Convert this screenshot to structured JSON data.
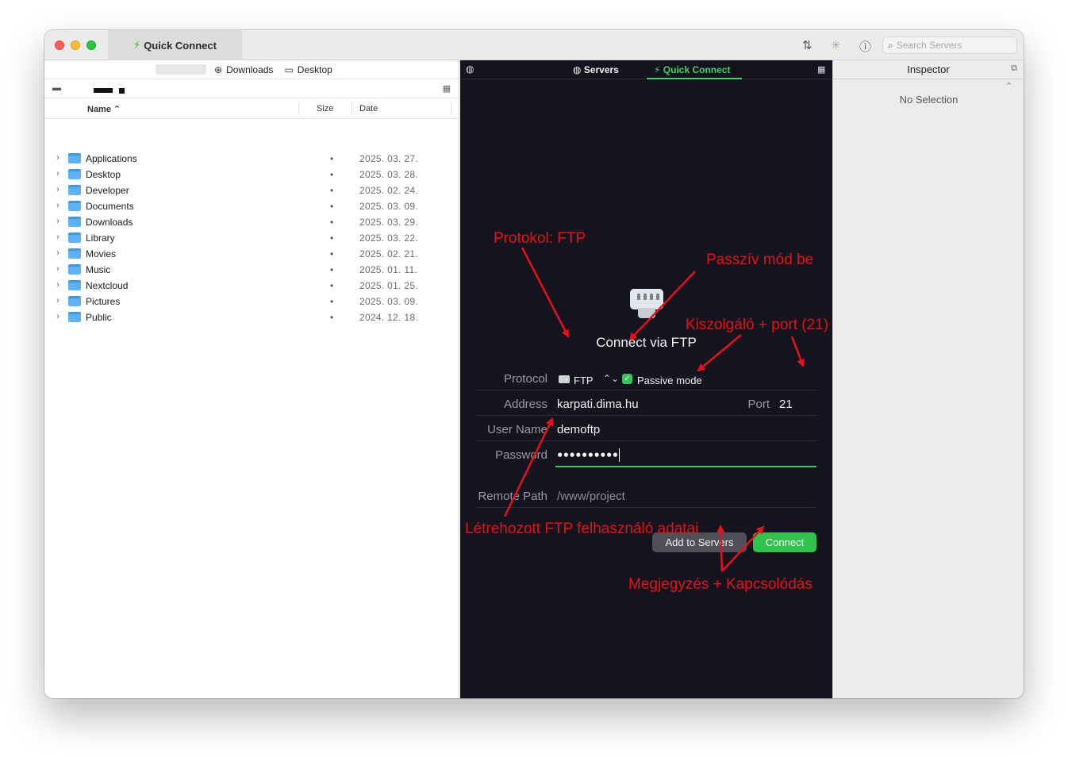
{
  "titlebar": {
    "tab_label": "Quick Connect",
    "search_placeholder": "Search Servers"
  },
  "icons": {
    "bolt": "bolt-icon",
    "transfer": "up-down-arrows-icon",
    "activity": "spinner-icon",
    "info": "info-icon",
    "search": "search-icon"
  },
  "left_pane": {
    "pathbar": [
      {
        "label": "Downloads",
        "icon": "download-circle-icon"
      },
      {
        "label": "Desktop",
        "icon": "desktop-icon"
      }
    ],
    "columns": {
      "name": "Name",
      "size": "Size",
      "date": "Date"
    },
    "files": [
      {
        "name": "Applications",
        "size": "•",
        "date": "2025. 03. 27."
      },
      {
        "name": "Desktop",
        "size": "•",
        "date": "2025. 03. 28."
      },
      {
        "name": "Developer",
        "size": "•",
        "date": "2025. 02. 24."
      },
      {
        "name": "Documents",
        "size": "•",
        "date": "2025. 03. 09."
      },
      {
        "name": "Downloads",
        "size": "•",
        "date": "2025. 03. 29."
      },
      {
        "name": "Library",
        "size": "•",
        "date": "2025. 03. 22."
      },
      {
        "name": "Movies",
        "size": "•",
        "date": "2025. 02. 21."
      },
      {
        "name": "Music",
        "size": "•",
        "date": "2025. 01. 11."
      },
      {
        "name": "Nextcloud",
        "size": "•",
        "date": "2025. 01. 25."
      },
      {
        "name": "Pictures",
        "size": "•",
        "date": "2025. 03. 09."
      },
      {
        "name": "Public",
        "size": "•",
        "date": "2024. 12. 18."
      }
    ]
  },
  "middle_pane": {
    "tabs": {
      "servers": "Servers",
      "quick_connect": "Quick Connect"
    },
    "title": "Connect via FTP",
    "protocol_label": "Protocol",
    "protocol_value": "FTP",
    "passive_mode_label": "Passive mode",
    "passive_mode_checked": true,
    "address_label": "Address",
    "address_value": "karpati.dima.hu",
    "port_label": "Port",
    "port_value": "21",
    "username_label": "User Name",
    "username_value": "demoftp",
    "password_label": "Password",
    "password_value": "●●●●●●●●●●",
    "remote_path_label": "Remote Path",
    "remote_path_placeholder": "/www/project",
    "add_button": "Add to Servers",
    "connect_button": "Connect",
    "accent_color": "#34c759"
  },
  "inspector": {
    "title": "Inspector",
    "empty_text": "No Selection"
  },
  "annotations": {
    "protocol": "Protokol: FTP",
    "passive": "Passzív mód be",
    "server_port": "Kiszolgáló + port (21)",
    "credentials": "Létrehozott FTP felhasználó adatai",
    "buttons": "Megjegyzés + Kapcsolódás",
    "color": "#e8101a"
  }
}
